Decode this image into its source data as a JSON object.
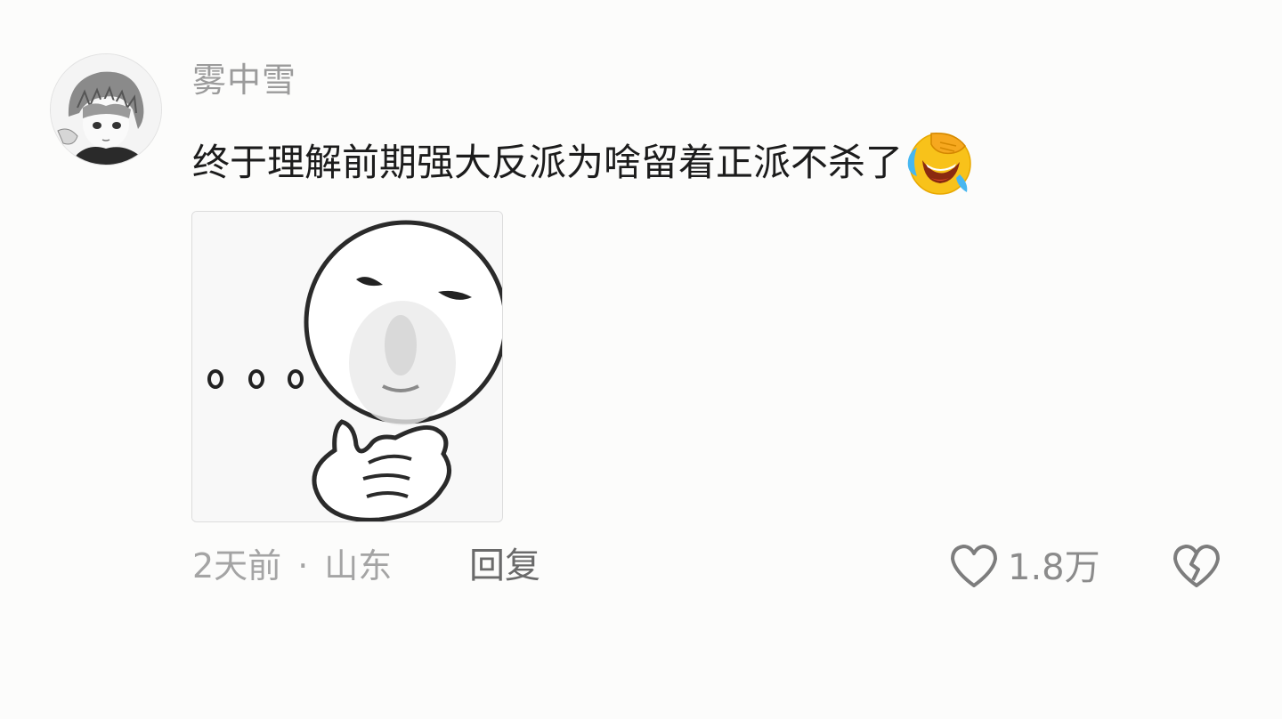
{
  "comment": {
    "username": "雾中雪",
    "text": "终于理解前期强大反派为啥留着正派不杀了",
    "emoji": "laughing-crying-emoji",
    "sticker": "thinking-meme-sticker",
    "time": "2天前",
    "separator": "·",
    "location": "山东",
    "reply_label": "回复",
    "like_count": "1.8万",
    "icons": {
      "like": "heart-outline-icon",
      "dislike": "broken-heart-icon"
    }
  }
}
